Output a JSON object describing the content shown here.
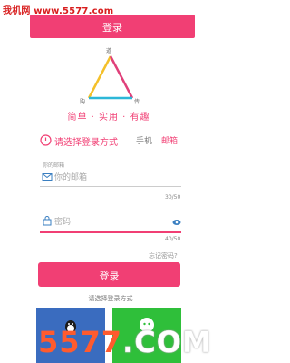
{
  "watermark_top": "我机网 www.5577.com",
  "header": {
    "title": "登录"
  },
  "logo": {
    "labels": {
      "top": "道",
      "left": "购",
      "right": "传"
    }
  },
  "tagline": "简单 · 实用 · 有趣",
  "login_mode": {
    "label": "请选择登录方式",
    "tabs": [
      {
        "label": "手机"
      },
      {
        "label": "邮箱"
      }
    ],
    "active_tab": "邮箱"
  },
  "email": {
    "caption": "你的邮箱",
    "placeholder": "你的邮箱",
    "counter": "30/50"
  },
  "password": {
    "placeholder": "密码",
    "counter": "40/50"
  },
  "forgot_label": "忘记密码?",
  "login_button": "登录",
  "other_login_label": "请选择登录方式",
  "colors": {
    "accent": "#f13f74",
    "qq": "#3a6cbf",
    "wechat": "#2fbf3a"
  },
  "icons": {
    "mode": "clock-icon",
    "email": "envelope-icon",
    "password": "lock-icon",
    "visibility": "eye-icon",
    "qq": "qq-icon",
    "wechat": "wechat-icon"
  },
  "watermark_bottom": {
    "number": "5577",
    "domain": ".COM"
  }
}
